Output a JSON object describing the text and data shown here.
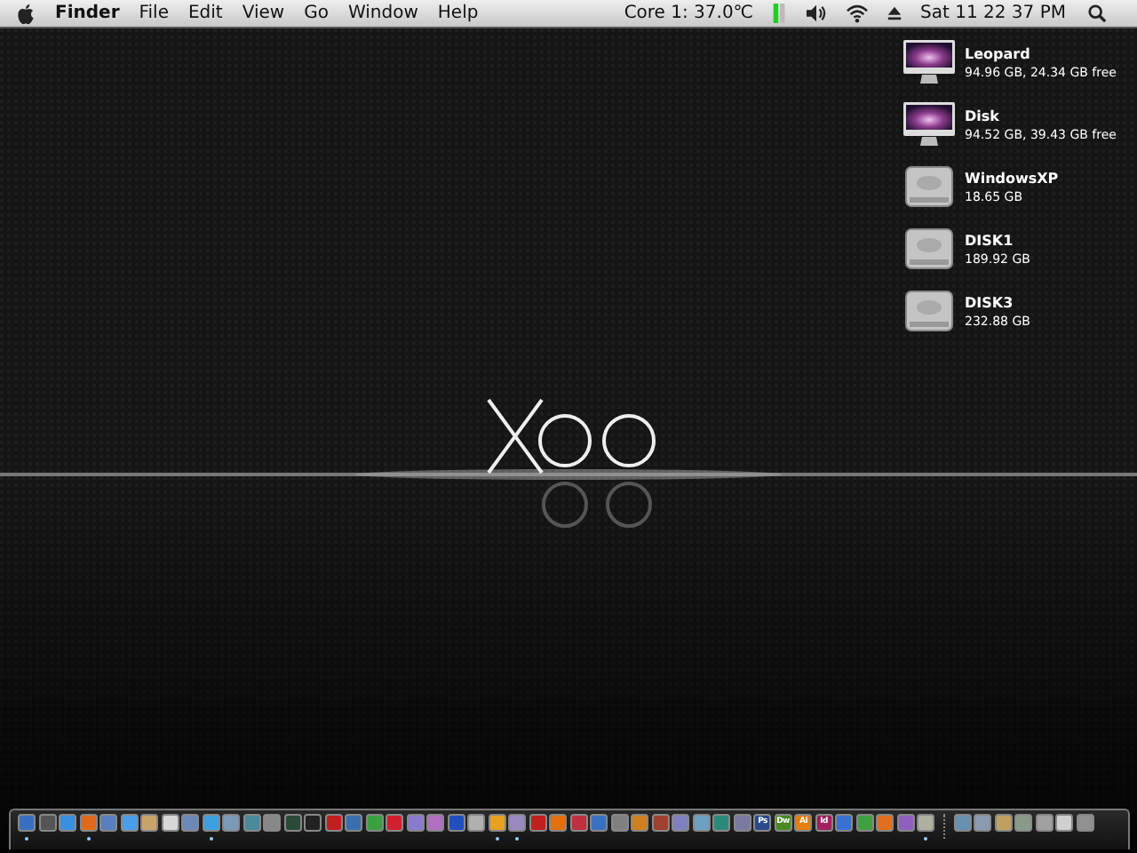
{
  "menu_bar": {
    "app_name": "Finder",
    "menus": [
      "File",
      "Edit",
      "View",
      "Go",
      "Window",
      "Help"
    ],
    "temperature": "Core 1: 37.0℃",
    "clock": "Sat 11 22 37 PM"
  },
  "desktop_icons": [
    {
      "kind": "computer",
      "name": "Leopard",
      "info": "94.96 GB, 24.34 GB free"
    },
    {
      "kind": "computer",
      "name": "Disk",
      "info": "94.52 GB, 39.43 GB free"
    },
    {
      "kind": "drive",
      "name": "WindowsXP",
      "info": "18.65 GB"
    },
    {
      "kind": "drive",
      "name": "DISK1",
      "info": "189.92 GB"
    },
    {
      "kind": "drive",
      "name": "DISK3",
      "info": "232.88 GB"
    }
  ],
  "dock": [
    {
      "kind": "app",
      "color": "#3a6fc0",
      "running": true
    },
    {
      "kind": "app",
      "color": "#555555",
      "running": false
    },
    {
      "kind": "app",
      "color": "#3b8fe0",
      "running": false
    },
    {
      "kind": "app",
      "color": "#e06a1a",
      "running": true
    },
    {
      "kind": "app",
      "color": "#5a7fc0",
      "running": false
    },
    {
      "kind": "app",
      "color": "#4a9de8",
      "running": false
    },
    {
      "kind": "app",
      "color": "#c9a46a",
      "running": false
    },
    {
      "kind": "app",
      "color": "#d8d8d8",
      "running": false
    },
    {
      "kind": "app",
      "color": "#6a88b8",
      "running": false
    },
    {
      "kind": "app",
      "color": "#3fa0e0",
      "running": true
    },
    {
      "kind": "app",
      "color": "#7a9ab8",
      "running": false
    },
    {
      "kind": "app",
      "color": "#4a8a9a",
      "running": false
    },
    {
      "kind": "app",
      "color": "#888888",
      "running": false
    },
    {
      "kind": "app",
      "color": "#2a4a3a",
      "running": false
    },
    {
      "kind": "app",
      "color": "#222222",
      "running": false
    },
    {
      "kind": "app",
      "color": "#c02020",
      "running": false
    },
    {
      "kind": "app",
      "color": "#3a6fb0",
      "running": false
    },
    {
      "kind": "app",
      "color": "#3aa040",
      "running": false
    },
    {
      "kind": "app",
      "color": "#d02030",
      "running": false
    },
    {
      "kind": "app",
      "color": "#8a7ad0",
      "running": false
    },
    {
      "kind": "app",
      "color": "#b070c0",
      "running": false
    },
    {
      "kind": "app",
      "color": "#2050c0",
      "running": false
    },
    {
      "kind": "app",
      "color": "#b0b0b0",
      "running": false
    },
    {
      "kind": "app",
      "color": "#e8a020",
      "running": true
    },
    {
      "kind": "app",
      "color": "#9a8ac0",
      "running": true
    },
    {
      "kind": "app",
      "color": "#c02020",
      "running": false
    },
    {
      "kind": "app",
      "color": "#e07010",
      "running": false
    },
    {
      "kind": "app",
      "color": "#c03040",
      "running": false
    },
    {
      "kind": "app",
      "color": "#3a70c0",
      "running": false
    },
    {
      "kind": "app",
      "color": "#808080",
      "running": false
    },
    {
      "kind": "app",
      "color": "#d08020",
      "running": false
    },
    {
      "kind": "app",
      "color": "#a04030",
      "running": false
    },
    {
      "kind": "app",
      "color": "#8080c0",
      "running": false
    },
    {
      "kind": "app",
      "color": "#6aa0c0",
      "running": false
    },
    {
      "kind": "app",
      "color": "#2a8a7a",
      "running": false
    },
    {
      "kind": "app",
      "color": "#7a7aa0",
      "running": false
    },
    {
      "kind": "app",
      "color": "#2a4a8a",
      "label": "Ps",
      "running": false
    },
    {
      "kind": "app",
      "color": "#4a8a20",
      "label": "Dw",
      "running": false
    },
    {
      "kind": "app",
      "color": "#e08010",
      "label": "Ai",
      "running": false
    },
    {
      "kind": "app",
      "color": "#a02060",
      "label": "Id",
      "running": false
    },
    {
      "kind": "app",
      "color": "#3a70d0",
      "running": false
    },
    {
      "kind": "app",
      "color": "#40a040",
      "running": false
    },
    {
      "kind": "app",
      "color": "#e07020",
      "running": false
    },
    {
      "kind": "app",
      "color": "#9060c0",
      "running": false
    },
    {
      "kind": "app",
      "color": "#b0b0a0",
      "running": true
    },
    {
      "kind": "separator"
    },
    {
      "kind": "app",
      "color": "#6a90b0",
      "running": false
    },
    {
      "kind": "app",
      "color": "#8a9ab0",
      "running": false
    },
    {
      "kind": "app",
      "color": "#c0a060",
      "running": false
    },
    {
      "kind": "app",
      "color": "#8a9a8a",
      "running": false
    },
    {
      "kind": "app",
      "color": "#a0a0a0",
      "running": false
    },
    {
      "kind": "app",
      "color": "#d0d0d0",
      "running": false
    },
    {
      "kind": "app",
      "color": "#909090",
      "running": false
    }
  ]
}
